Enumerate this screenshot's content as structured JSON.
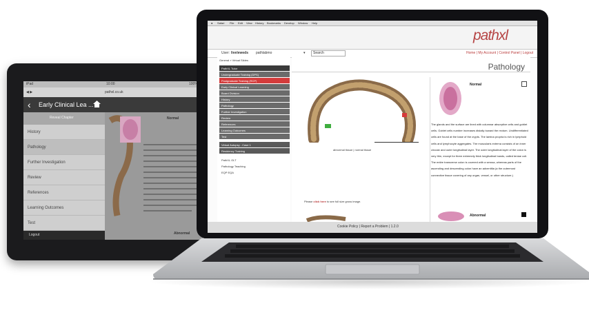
{
  "tablet": {
    "statusbar": {
      "left": "iPad",
      "center": "10:00",
      "right": "100%"
    },
    "url": "pathxl.co.uk",
    "nav_title": "Early Clinical Lea ...",
    "menu_header": "Reveal Chapter",
    "menu_items": [
      {
        "label": "History"
      },
      {
        "label": "Pathology"
      },
      {
        "label": "Further Investigation"
      },
      {
        "label": "Review"
      },
      {
        "label": "References"
      },
      {
        "label": "Learning Outcomes"
      },
      {
        "label": "Test"
      }
    ],
    "logout": "Logout",
    "content_heading": "Normal",
    "content_footer": "Abnormal"
  },
  "laptop": {
    "mac_menu": [
      "Safari",
      "File",
      "Edit",
      "View",
      "History",
      "Bookmarks",
      "Develop",
      "Window",
      "Help"
    ],
    "logo": "pathxl",
    "user_label": "User:",
    "user_name": "liveleweds",
    "search_value": "pathlabmo",
    "search_button": "Search",
    "user_links": "Home | My Account | Control Panel | Logout",
    "breadcrumb": "General » Virtual Slides",
    "sidebar_items": [
      {
        "label": "PathXL Tutor",
        "style": "dark"
      },
      {
        "label": "Undergraduate Training (DPS)",
        "style": "grey"
      },
      {
        "label": "Postgraduate Training (RCP)",
        "style": "active"
      },
      {
        "label": "Early Clinical Learning",
        "style": "grey"
      },
      {
        "label": "Board Division",
        "style": "grey"
      },
      {
        "label": "History",
        "style": "grey"
      },
      {
        "label": "Pathology",
        "style": "grey"
      },
      {
        "label": "Further Investigation",
        "style": "grey"
      },
      {
        "label": "Review",
        "style": "grey"
      },
      {
        "label": "References",
        "style": "grey"
      },
      {
        "label": "Learning Outcomes",
        "style": "grey"
      },
      {
        "label": "Test",
        "style": "grey"
      },
      {
        "label": "Virtual Autopsy - Case 1",
        "style": "mid"
      },
      {
        "label": "Residency Training",
        "style": "mid"
      },
      {
        "label": "PathXL OLT",
        "style": "light"
      },
      {
        "label": "Pathology Teaching",
        "style": "light"
      },
      {
        "label": "EQP EQA",
        "style": "light"
      }
    ],
    "page_title": "Pathology",
    "image_caption": "abnormal tissue | normal tissue",
    "link_prefix": "Please",
    "link_text": "click here",
    "link_suffix": "to see full size gross image.",
    "normal_label": "Normal",
    "description": "The glands and the surface are lined with columnar absorptive cells and goblet cells. Goblet cells number increases distally toward the rectum. Undifferentiated cells are found at the base of the crypts. The lamina propria is rich in lymphoid cells and lymphocyte aggregates. The muscularis externa consists of an inner circular and outer longitudinal layer. The outer longitudinal layer of the colon is very thin, except for three extremely thick longitudinal bands, called teniae coli. The entire transverse colon is covered with a serosa, whereas parts of the ascending and descending colon have an adventitia (a the outermost connective tissue covering of any organ, vessel, or other structure.)",
    "abnormal_label": "Abnormal",
    "footer": "Cookie Policy | Report a Problem | 1.2.0"
  }
}
